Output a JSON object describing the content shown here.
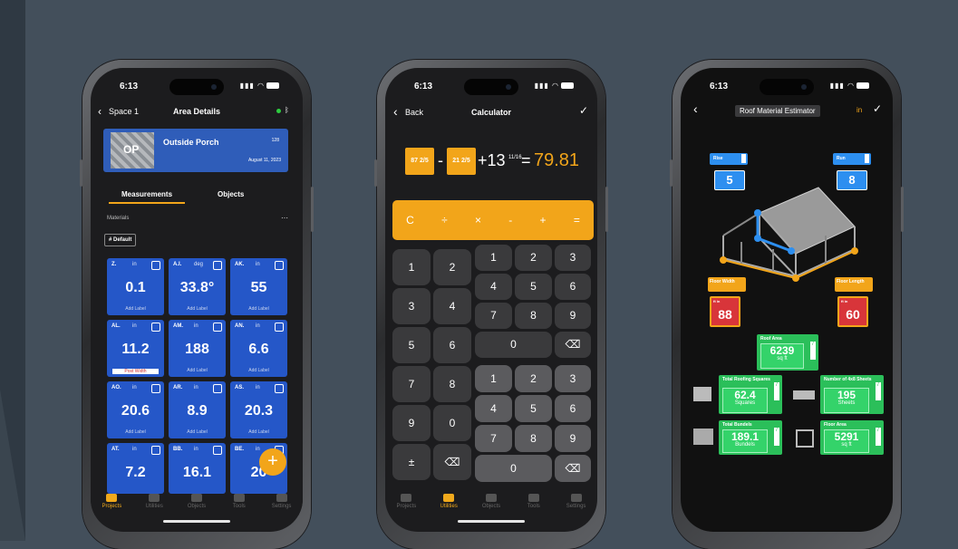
{
  "status": {
    "time": "6:13"
  },
  "phone1": {
    "back_label": "Space 1",
    "title": "Area Details",
    "area": {
      "initials": "OP",
      "name": "Outside Porch",
      "count": "128",
      "date": "August 11, 2023"
    },
    "tabs": [
      "Measurements",
      "Objects"
    ],
    "section_label": "Materials",
    "menu_dots": "···",
    "filter_label": "# Default",
    "tiles": [
      {
        "label": "Z.",
        "unit": "in",
        "value": "0.1",
        "footer": "Add Label"
      },
      {
        "label": "A.I.",
        "unit": "deg",
        "value": "33.8°",
        "footer": "Add Label"
      },
      {
        "label": "AK.",
        "unit": "in",
        "value": "55",
        "footer": "Add Label"
      },
      {
        "label": "AL.",
        "unit": "in",
        "value": "11.2",
        "footer": "Post Width"
      },
      {
        "label": "AM.",
        "unit": "in",
        "value": "188",
        "footer": "Add Label"
      },
      {
        "label": "AN.",
        "unit": "in",
        "value": "6.6",
        "footer": "Add Label"
      },
      {
        "label": "AO.",
        "unit": "in",
        "value": "20.6",
        "footer": "Add Label"
      },
      {
        "label": "AR.",
        "unit": "in",
        "value": "8.9",
        "footer": "Add Label"
      },
      {
        "label": "AS.",
        "unit": "in",
        "value": "20.3",
        "footer": "Add Label"
      },
      {
        "label": "AT.",
        "unit": "in",
        "value": "7.2",
        "footer": ""
      },
      {
        "label": "BB.",
        "unit": "in",
        "value": "16.1",
        "footer": ""
      },
      {
        "label": "BE.",
        "unit": "in",
        "value": "20",
        "footer": ""
      }
    ],
    "fab_label": "+",
    "tabbar": [
      "Projects",
      "Utilities",
      "Objects",
      "Tools",
      "Settings"
    ]
  },
  "phone2": {
    "back_label": "Back",
    "title": "Calculator",
    "confirm_icon": "check-icon",
    "expression": {
      "frac1": "87 2/5",
      "minus": "-",
      "frac2": "21 2/5",
      "plus_term": "+13",
      "plus_frac": "11/16",
      "equals": "=",
      "result": "79.81"
    },
    "ops": [
      "C",
      "÷",
      "×",
      "-",
      "+",
      "="
    ],
    "fraction_keys": [
      "1",
      "2",
      "3",
      "4",
      "5",
      "6",
      "7",
      "8",
      "9",
      "0",
      "±",
      "⌫"
    ],
    "digit_keys_upper": [
      "1",
      "2",
      "3",
      "4",
      "5",
      "6",
      "7",
      "8",
      "9",
      "0",
      "⌫"
    ],
    "digit_keys_lower": [
      "1",
      "2",
      "3",
      "4",
      "5",
      "6",
      "7",
      "8",
      "9",
      "0",
      "⌫"
    ],
    "tabbar": [
      "Projects",
      "Utilities",
      "Objects",
      "Tools",
      "Settings"
    ]
  },
  "phone3": {
    "title": "Roof Material Estimator",
    "unit_toggle": "in",
    "rise": {
      "label": "Rise",
      "value": "5"
    },
    "run": {
      "label": "Run",
      "value": "8"
    },
    "floor_width": {
      "label": "Floor Width",
      "unit": "ft in",
      "value": "88"
    },
    "floor_length": {
      "label": "Floor Length",
      "unit": "ft in",
      "value": "60"
    },
    "roof_area": {
      "label": "Roof Area",
      "value": "6239",
      "unit": "sq ft"
    },
    "roofing_squares": {
      "label": "Total Roofing Squares",
      "value": "62.4",
      "unit": "Squares"
    },
    "sheets": {
      "label": "Number of 4x8 Sheets",
      "value": "195",
      "unit": "Sheets"
    },
    "bundles": {
      "label": "Total Bundels",
      "value": "189.1",
      "unit": "Bundels"
    },
    "floor_area": {
      "label": "Floor Area",
      "value": "5291",
      "unit": "sq ft"
    }
  },
  "colors": {
    "accent": "#f2a51a",
    "tile_blue": "#2557c8",
    "green": "#2bbf5a",
    "red": "#d8353a",
    "background": "#434f5b"
  }
}
